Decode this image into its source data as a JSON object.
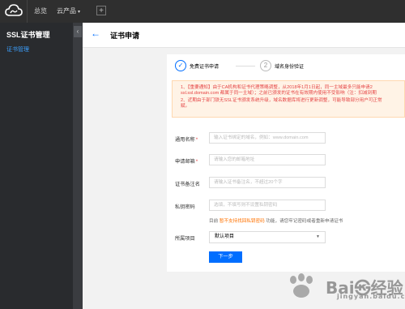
{
  "topbar": {
    "nav_overview": "总览",
    "nav_products": "云产品",
    "products_caret": "▾",
    "plus": "+"
  },
  "sidebar": {
    "title": "SSL证书管理",
    "item": "证书管理",
    "collapse": "‹"
  },
  "header": {
    "back": "←",
    "title": "证书申请"
  },
  "steps": [
    {
      "number": "✓",
      "label": "免费证书申请"
    },
    {
      "number": "2",
      "label": "域名身份验证"
    }
  ],
  "notice": {
    "line1": "1、【重要通知】由于CA机构和证书代理策略调整，从2018年1月1日起，同一主域最多只能申请2",
    "line2": "ssl.ssl.domain.com 都属于同一主域）；之前已颁发的证书在有效期内使用不受影响（注：扣减到期",
    "line3": "2、近期由于部门铁无SSL证书颁发系统升级，域名数据库将进行更新调整，可能导致部分用户可正常",
    "line4": "赋。"
  },
  "form": {
    "domain_label": "通用名称",
    "domain_placeholder": "输入证书绑定的域名，例如：www.domain.com",
    "email_label": "申请邮箱",
    "email_placeholder": "请输入您的邮箱地址",
    "remark_label": "证书备注名",
    "remark_placeholder": "请输入证书备注名，不超过20个字",
    "password_label": "私钥密码",
    "password_placeholder": "选填，不填写则不设置私钥密码",
    "required_mark": "*",
    "hint_pre": "目前",
    "hint_link": "暂不支持找回私钥密码",
    "hint_post": "功能，请您牢记密码或者重新申请证书",
    "project_label": "所属项目",
    "project_value": "默认项目",
    "project_caret": "▼",
    "next_button": "下一步"
  },
  "watermark": {
    "brand": "Bai㉿经验",
    "sub": "jingyan.baidu.com"
  }
}
